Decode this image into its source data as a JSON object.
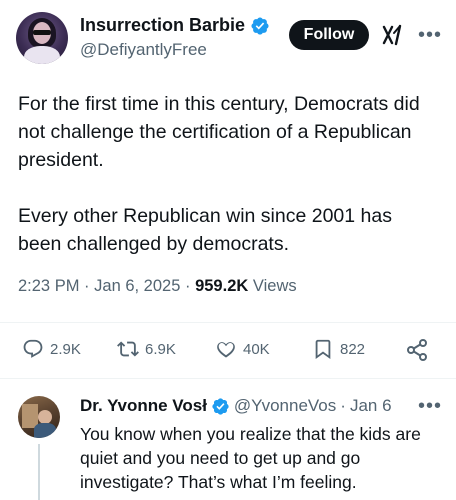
{
  "tweet": {
    "display_name": "Insurrection Barbie",
    "handle": "@DefiyantlyFree",
    "follow_label": "Follow",
    "text": "For the first time in this century, Democrats did not challenge the certification of a Republican president.\n\nEvery other Republican win since 2001 has been challenged by democrats.",
    "time": "2:23 PM",
    "date": "Jan 6, 2025",
    "views_count": "959.2K",
    "views_label": "Views",
    "separator": "·"
  },
  "actions": {
    "replies": "2.9K",
    "reposts": "6.9K",
    "likes": "40K",
    "bookmarks": "822"
  },
  "reply": {
    "display_name": "Dr. Yvonne Vosł",
    "handle": "@YvonneVos",
    "separator": "·",
    "date": "Jan 6",
    "text": "You know when you realize that the kids are quiet and you need to get up and go investigate? That’s what I’m feeling."
  },
  "colors": {
    "verified": "#1d9bf0",
    "text_primary": "#0f1419",
    "text_secondary": "#536471"
  },
  "icons": {
    "verified": "verified-badge-icon",
    "grok": "grok-icon",
    "more": "more-icon",
    "reply": "reply-icon",
    "repost": "repost-icon",
    "like": "heart-icon",
    "bookmark": "bookmark-icon",
    "share": "share-icon"
  }
}
